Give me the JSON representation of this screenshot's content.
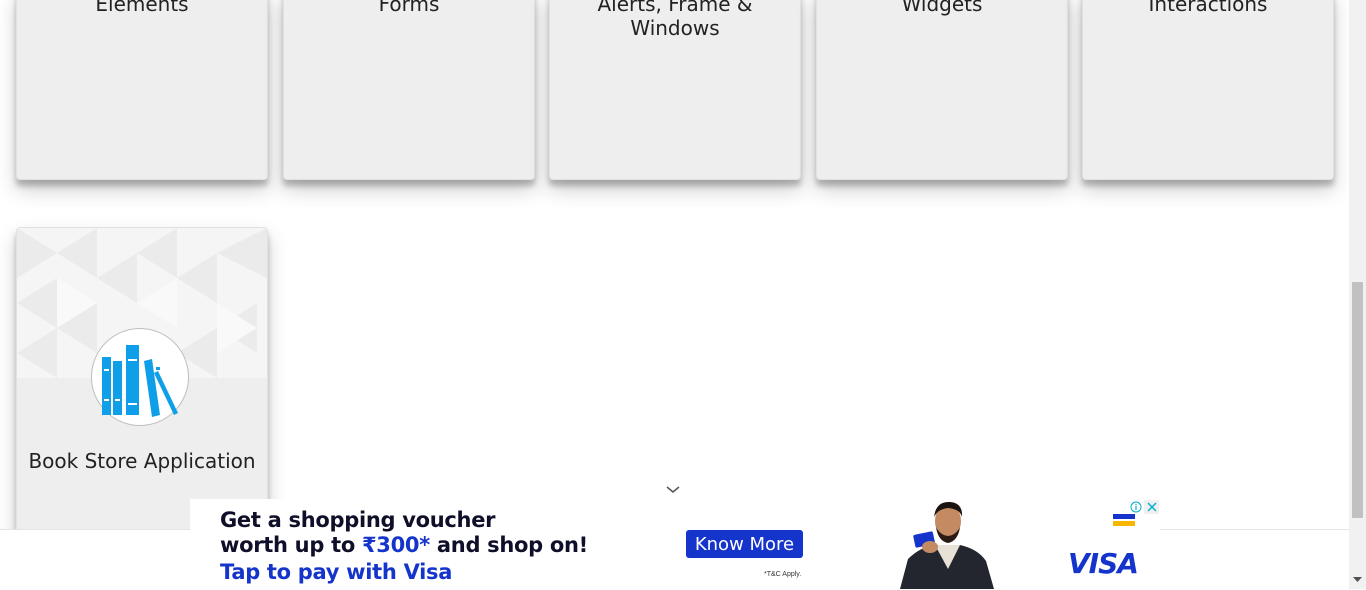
{
  "cards": [
    {
      "title": "Elements"
    },
    {
      "title": "Forms"
    },
    {
      "title": "Alerts, Frame & Windows"
    },
    {
      "title": "Widgets"
    },
    {
      "title": "Interactions"
    }
  ],
  "book_store": {
    "title": "Book Store Application"
  },
  "ad": {
    "line1": "Get a shopping voucher",
    "line2_prefix": "worth up to ",
    "line2_amount": "₹300*",
    "line2_suffix": " and shop on!",
    "line3": "Tap to pay with Visa",
    "button": "Know More",
    "terms": "*T&C Apply.",
    "brand": "VISA"
  },
  "colors": {
    "visa_blue": "#1434cb",
    "card_bg": "#eeeeee",
    "icon_blue": "#0e9fe8"
  }
}
